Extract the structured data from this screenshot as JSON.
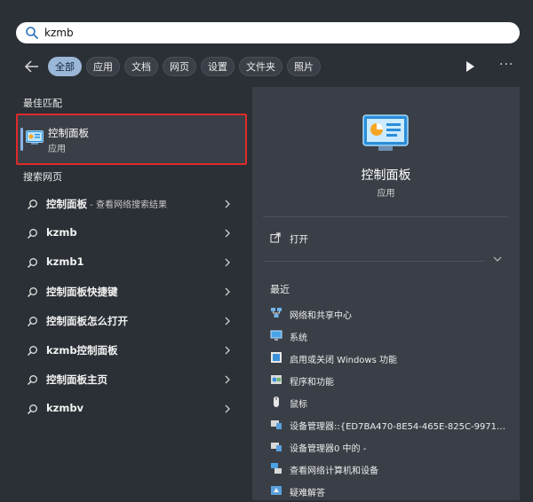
{
  "search": {
    "value": "kzmb",
    "placeholder": ""
  },
  "filters": {
    "tabs": [
      "全部",
      "应用",
      "文档",
      "网页",
      "设置",
      "文件夹",
      "照片"
    ],
    "active_index": 0
  },
  "best_match": {
    "heading": "最佳匹配",
    "title": "控制面板",
    "subtitle": "应用",
    "highlight_color": "#e12a2a"
  },
  "web_search": {
    "heading": "搜索网页",
    "results": [
      {
        "text": "控制面板",
        "sub": " - 查看网络搜索结果"
      },
      {
        "text": "kzmb",
        "sub": ""
      },
      {
        "text": "kzmb1",
        "sub": ""
      },
      {
        "text": "控制面板快捷键",
        "sub": ""
      },
      {
        "text": "控制面板怎么打开",
        "sub": ""
      },
      {
        "text": "kzmb控制面板",
        "sub": ""
      },
      {
        "text": "控制面板主页",
        "sub": ""
      },
      {
        "text": "kzmbv",
        "sub": ""
      }
    ]
  },
  "detail": {
    "title": "控制面板",
    "subtitle": "应用",
    "open_label": "打开",
    "recent_heading": "最近",
    "recent": [
      {
        "label": "网络和共享中心",
        "icon": "network-icon"
      },
      {
        "label": "系统",
        "icon": "monitor-icon"
      },
      {
        "label": "启用或关闭 Windows 功能",
        "icon": "windows-features-icon"
      },
      {
        "label": "程序和功能",
        "icon": "programs-icon"
      },
      {
        "label": "鼠标",
        "icon": "mouse-icon"
      },
      {
        "label": "设备管理器::{ED7BA470-8E54-465E-825C-997120...",
        "icon": "device-manager-icon"
      },
      {
        "label": "设备管理器0 中的 -",
        "icon": "device-manager-icon"
      },
      {
        "label": "查看网络计算机和设备",
        "icon": "network-computer-icon"
      },
      {
        "label": "疑难解答",
        "icon": "troubleshoot-icon"
      }
    ]
  },
  "colors": {
    "background": "#2b3037",
    "panel": "#3a3f47",
    "accent": "#9bb7d8"
  }
}
